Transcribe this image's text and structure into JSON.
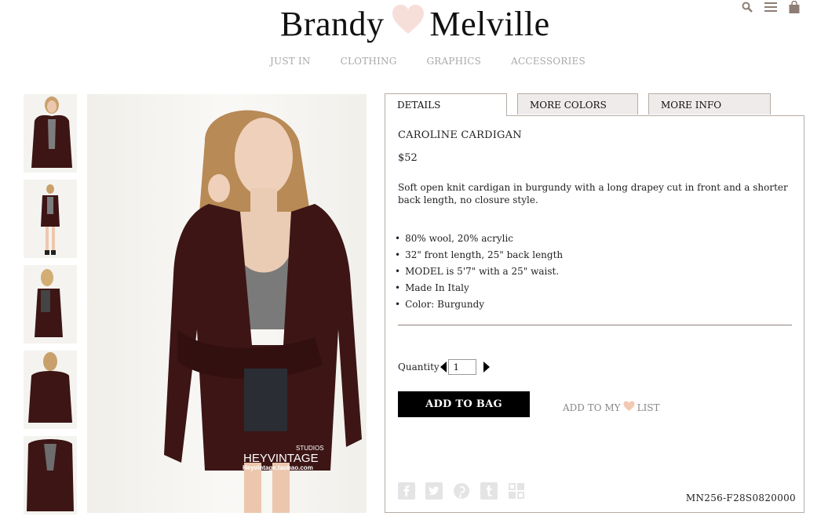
{
  "header": {
    "brand_left": "Brandy",
    "brand_right": "Melville",
    "icons": [
      "search-icon",
      "menu-icon",
      "shopping-bag-icon"
    ]
  },
  "nav": {
    "items": [
      "JUST IN",
      "CLOTHING",
      "GRAPHICS",
      "ACCESSORIES"
    ]
  },
  "gallery": {
    "thumbnail_count": 5,
    "watermark": {
      "line1": "STUDIOS",
      "line2": "HEYVINTAGE",
      "line3": "Heyvintage.taobao.com"
    }
  },
  "tabs": [
    {
      "label": "DETAILS",
      "active": true
    },
    {
      "label": "MORE COLORS",
      "active": false
    },
    {
      "label": "MORE INFO",
      "active": false
    }
  ],
  "product": {
    "name": "CAROLINE CARDIGAN",
    "price": "$52",
    "description": "Soft open knit cardigan in burgundy with a long drapey cut in front and a shorter back length, no closure style.",
    "bullets": [
      "80% wool, 20% acrylic",
      "32\" front length, 25\" back length",
      "MODEL is 5'7\" with a 25\" waist.",
      "Made In Italy",
      "Color: Burgundy"
    ],
    "sku": "MN256-F28S0820000"
  },
  "purchase": {
    "quantity_label": "Quantity",
    "quantity_value": "1",
    "add_to_bag": "ADD TO BAG",
    "wishlist_prefix": "ADD TO MY",
    "wishlist_suffix": "LIST"
  },
  "social": [
    "facebook-icon",
    "twitter-icon",
    "pinterest-icon",
    "tumblr-icon",
    "delicious-icon"
  ],
  "colors": {
    "accent_heart": "#f3c9b3",
    "tab_border": "#b5aca5",
    "cardigan": "#3d1515"
  }
}
